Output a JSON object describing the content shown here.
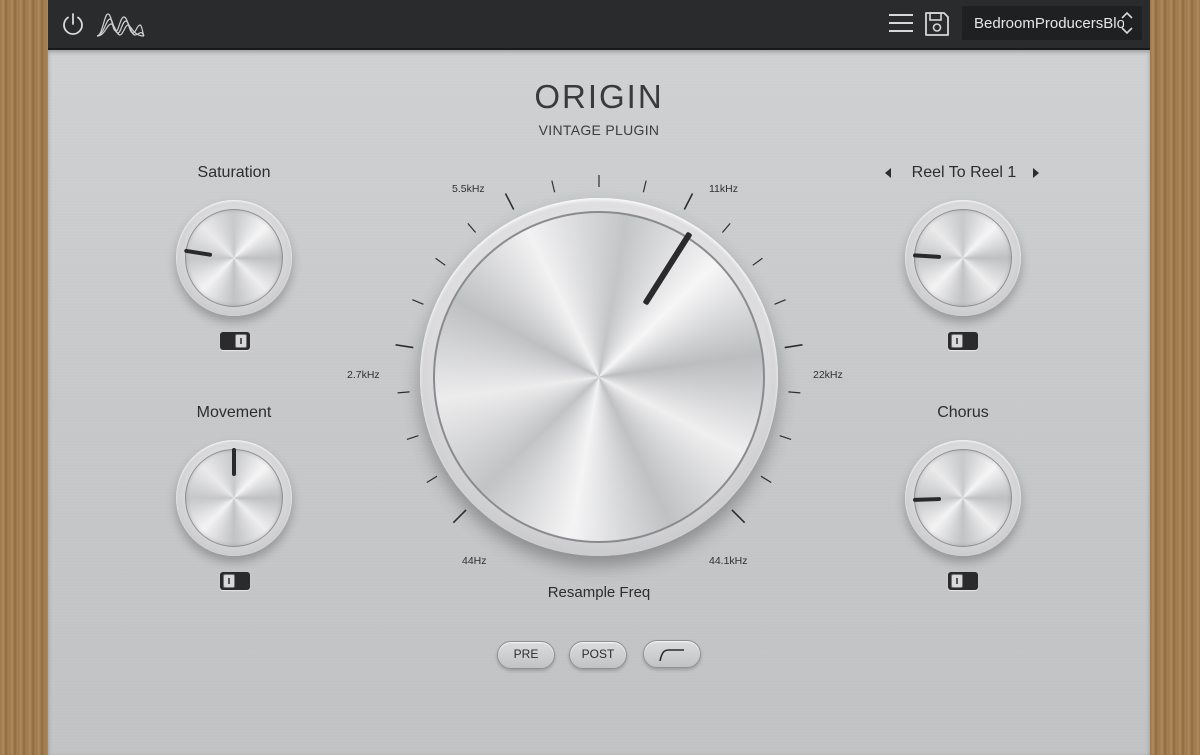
{
  "app": {
    "preset_name": "BedroomProducersBlog",
    "title": "ORIGIN",
    "subtitle": "VINTAGE PLUGIN"
  },
  "controls": {
    "saturation": {
      "label": "Saturation",
      "value": 0.2
    },
    "movement": {
      "label": "Movement",
      "value": 0.5
    },
    "tape": {
      "label": "Reel To Reel 1",
      "value": 0.18
    },
    "chorus": {
      "label": "Chorus",
      "value": 0.16
    },
    "resample": {
      "label": "Resample Freq",
      "value": 0.62,
      "ticks": {
        "min": "44Hz",
        "t1": "2.7kHz",
        "t2": "5.5kHz",
        "t3": "11kHz",
        "t4": "22kHz",
        "max": "44.1kHz"
      }
    }
  },
  "buttons": {
    "pre": "PRE",
    "post": "POST"
  },
  "icons": {
    "power": "power-icon",
    "logo": "waveform-logo-icon",
    "menu": "hamburger-menu-icon",
    "save": "save-icon",
    "preset_arrows": "updown-chevron-icon",
    "prev": "triangle-left-icon",
    "next": "triangle-right-icon",
    "filter": "filter-curve-icon"
  },
  "colors": {
    "topbar": "#2a2b2d",
    "panel": "#cbcccf",
    "pointer": "#2a2a2c"
  }
}
